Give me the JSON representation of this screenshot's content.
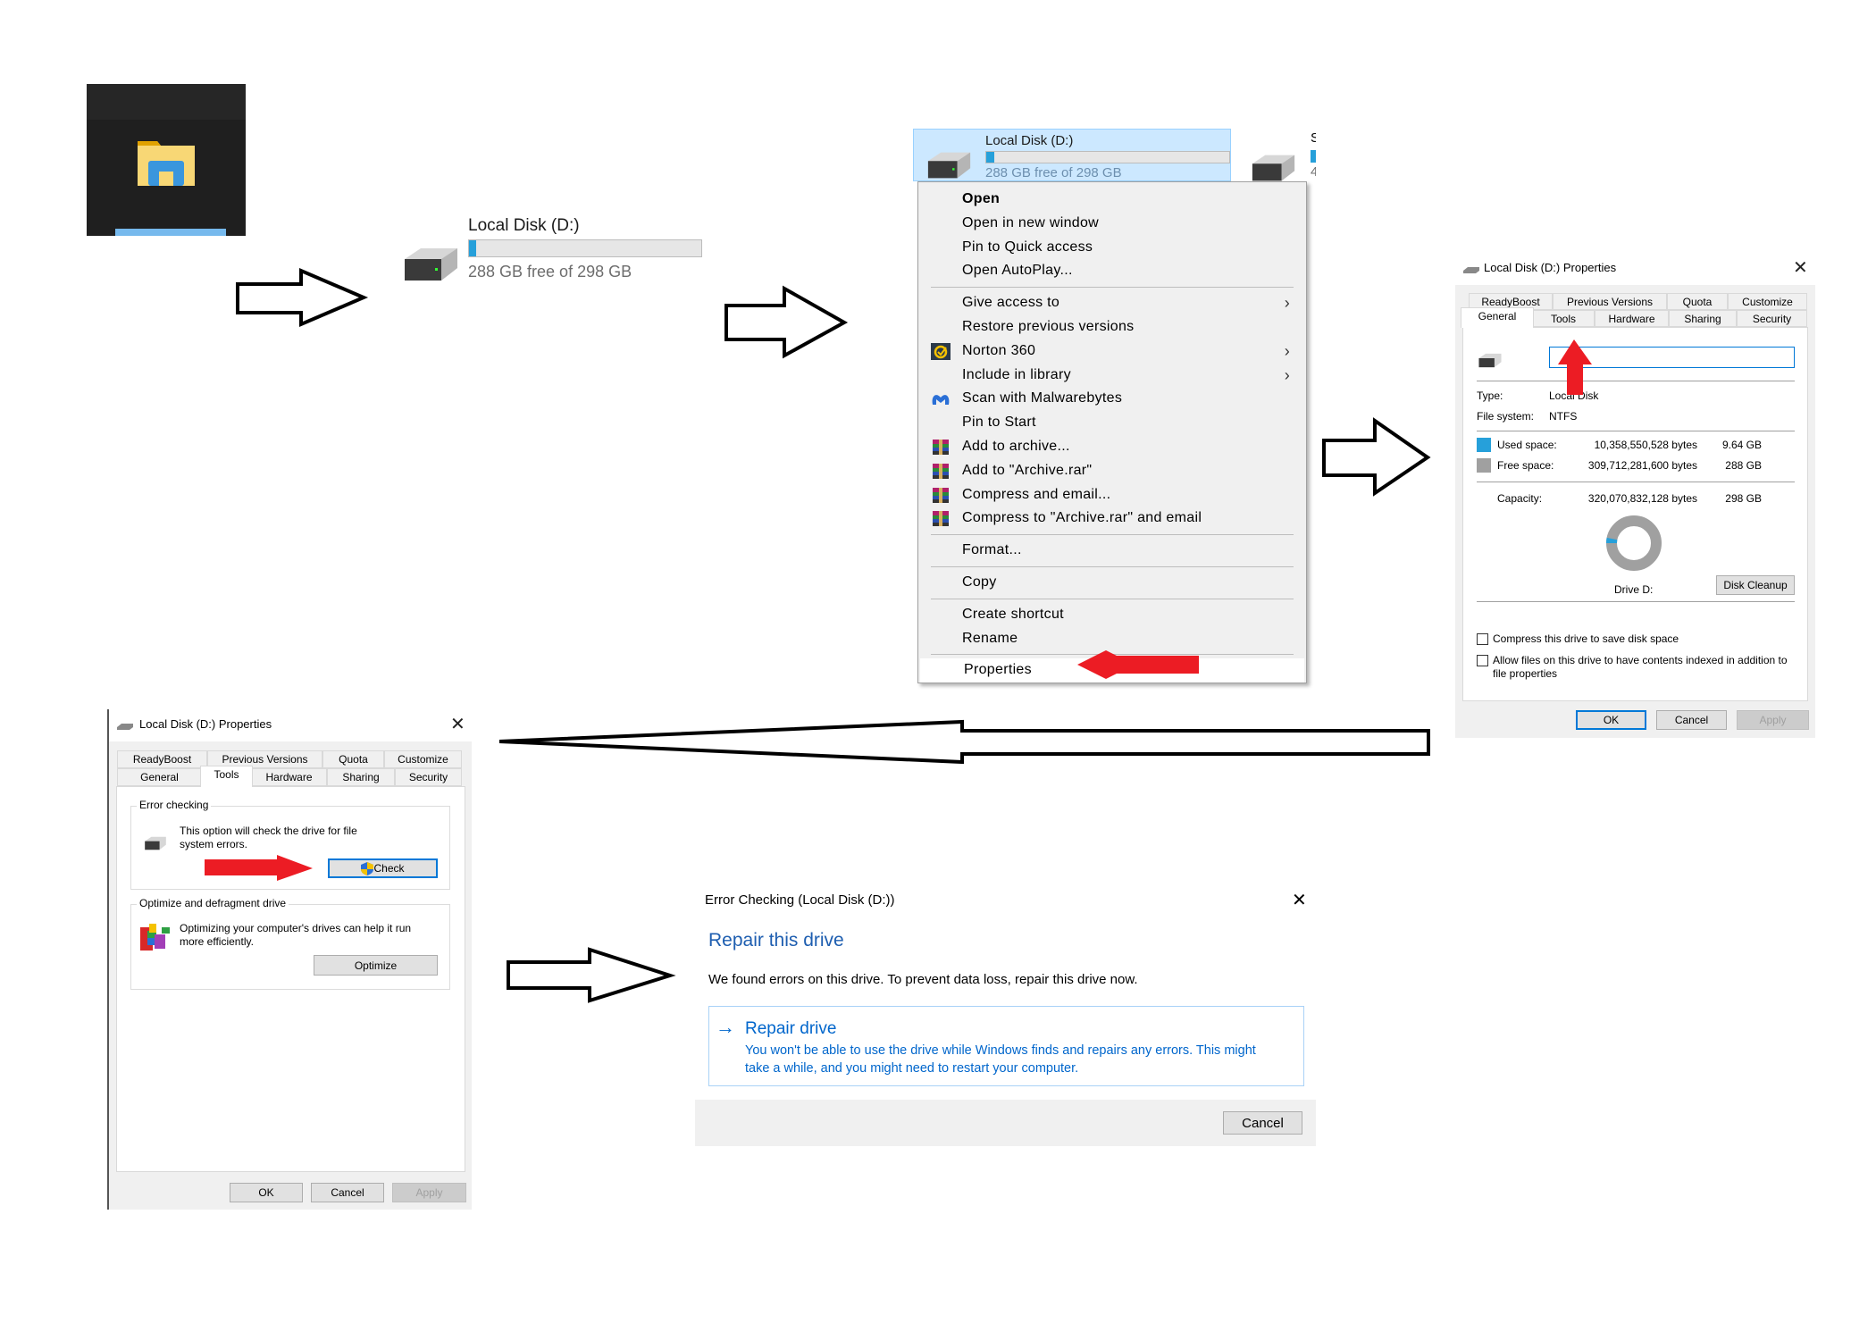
{
  "colors": {
    "accent": "#0078d7",
    "used": "#26a0da",
    "free": "#a0a0a0",
    "link_blue": "#0066cc",
    "annotation_red": "#ec1c24"
  },
  "taskbar": {
    "icon": "file-explorer-icon"
  },
  "drive_tile": {
    "name": "Local Disk (D:)",
    "free_text": "288 GB free of 298 GB",
    "used_fraction": 0.032
  },
  "context_menu": {
    "tile": {
      "name": "Local Disk (D:)",
      "free_text": "288 GB free of 298 GB",
      "neighbor_label_1": "S",
      "neighbor_label_2": "4"
    },
    "items": [
      {
        "label": "Open",
        "bold": true
      },
      {
        "label": "Open in new window"
      },
      {
        "label": "Pin to Quick access"
      },
      {
        "label": "Open AutoPlay..."
      },
      {
        "sep": true
      },
      {
        "label": "Give access to",
        "submenu": true
      },
      {
        "label": "Restore previous versions"
      },
      {
        "label": "Norton 360",
        "icon": "norton-icon",
        "submenu": true
      },
      {
        "label": "Include in library",
        "submenu": true
      },
      {
        "label": "Scan with Malwarebytes",
        "icon": "malwarebytes-icon"
      },
      {
        "label": "Pin to Start"
      },
      {
        "label": "Add to archive...",
        "icon": "winrar-icon"
      },
      {
        "label": "Add to \"Archive.rar\"",
        "icon": "winrar-icon"
      },
      {
        "label": "Compress and email...",
        "icon": "winrar-icon"
      },
      {
        "label": "Compress to \"Archive.rar\" and email",
        "icon": "winrar-icon"
      },
      {
        "sep": true
      },
      {
        "label": "Format..."
      },
      {
        "sep": true
      },
      {
        "label": "Copy"
      },
      {
        "sep": true
      },
      {
        "label": "Create shortcut"
      },
      {
        "label": "Rename"
      },
      {
        "sep": true
      },
      {
        "label": "Properties",
        "highlighted": true
      }
    ]
  },
  "properties_general": {
    "title": "Local Disk (D:) Properties",
    "tabs_row1": [
      "ReadyBoost",
      "Previous Versions",
      "Quota",
      "Customize"
    ],
    "tabs_row2": [
      "General",
      "Tools",
      "Hardware",
      "Sharing",
      "Security"
    ],
    "active_tab": "General",
    "name_value": "",
    "type_label": "Type:",
    "type_value": "Local Disk",
    "fs_label": "File system:",
    "fs_value": "NTFS",
    "used_label": "Used space:",
    "used_bytes": "10,358,550,528 bytes",
    "used_gb": "9.64 GB",
    "free_label": "Free space:",
    "free_bytes": "309,712,281,600 bytes",
    "free_gb": "288 GB",
    "cap_label": "Capacity:",
    "cap_bytes": "320,070,832,128 bytes",
    "cap_gb": "298 GB",
    "used_fraction": 0.032,
    "drive_label": "Drive D:",
    "disk_cleanup": "Disk Cleanup",
    "compress_label": "Compress this drive to save disk space",
    "index_label_1": "Allow files on this drive to have contents indexed in addition to",
    "index_label_2": "file properties",
    "compress_checked": false,
    "index_checked": false,
    "ok": "OK",
    "cancel": "Cancel",
    "apply": "Apply"
  },
  "properties_tools": {
    "title": "Local Disk (D:) Properties",
    "tabs_row1": [
      "ReadyBoost",
      "Previous Versions",
      "Quota",
      "Customize"
    ],
    "tabs_row2": [
      "General",
      "Tools",
      "Hardware",
      "Sharing",
      "Security"
    ],
    "active_tab": "Tools",
    "error_group": "Error checking",
    "error_text_1": "This option will check the drive for file",
    "error_text_2": "system errors.",
    "check": "Check",
    "optimize_group": "Optimize and defragment drive",
    "optimize_text_1": "Optimizing your computer's drives can help it run",
    "optimize_text_2": "more efficiently.",
    "optimize": "Optimize",
    "ok": "OK",
    "cancel": "Cancel",
    "apply": "Apply"
  },
  "error_checking": {
    "title": "Error Checking (Local Disk (D:))",
    "heading": "Repair this drive",
    "message": "We found errors on this drive. To prevent data loss, repair this drive now.",
    "option_title": "Repair drive",
    "option_desc_1": "You won't be able to use the drive while Windows finds and repairs any errors. This might",
    "option_desc_2": "take a while, and you might need to restart your computer.",
    "cancel": "Cancel"
  }
}
